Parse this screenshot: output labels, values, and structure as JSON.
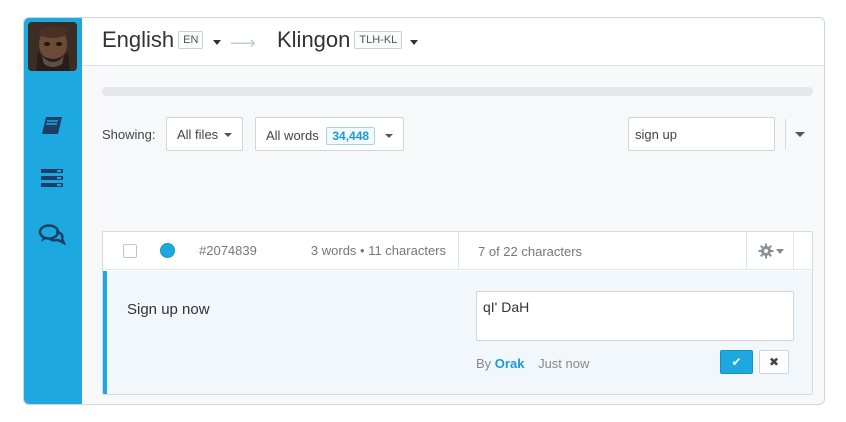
{
  "header": {
    "source_lang": "English",
    "source_code": "EN",
    "target_lang": "Klingon",
    "target_code": "TLH-KL"
  },
  "sidebar": {
    "items": [
      {
        "icon": "book-icon"
      },
      {
        "icon": "list-icon"
      },
      {
        "icon": "comments-icon"
      }
    ]
  },
  "progress": {
    "percent": 0
  },
  "filters": {
    "showing_label": "Showing:",
    "files": "All files",
    "words": "All words",
    "word_count": "34,448",
    "search_value": "sign up"
  },
  "string": {
    "id": "#2074839",
    "source_stats": "3 words • 11 characters",
    "translation_stats": "7 of 22 characters",
    "source_text": "Sign up now",
    "translation_text": "qI' DaH",
    "by_label": "By",
    "author": "Orak",
    "time": "Just now",
    "save_glyph": "✔",
    "cancel_glyph": "✖"
  },
  "colors": {
    "accent": "#1ea8e0",
    "sidebar": "#1ea8e0"
  }
}
